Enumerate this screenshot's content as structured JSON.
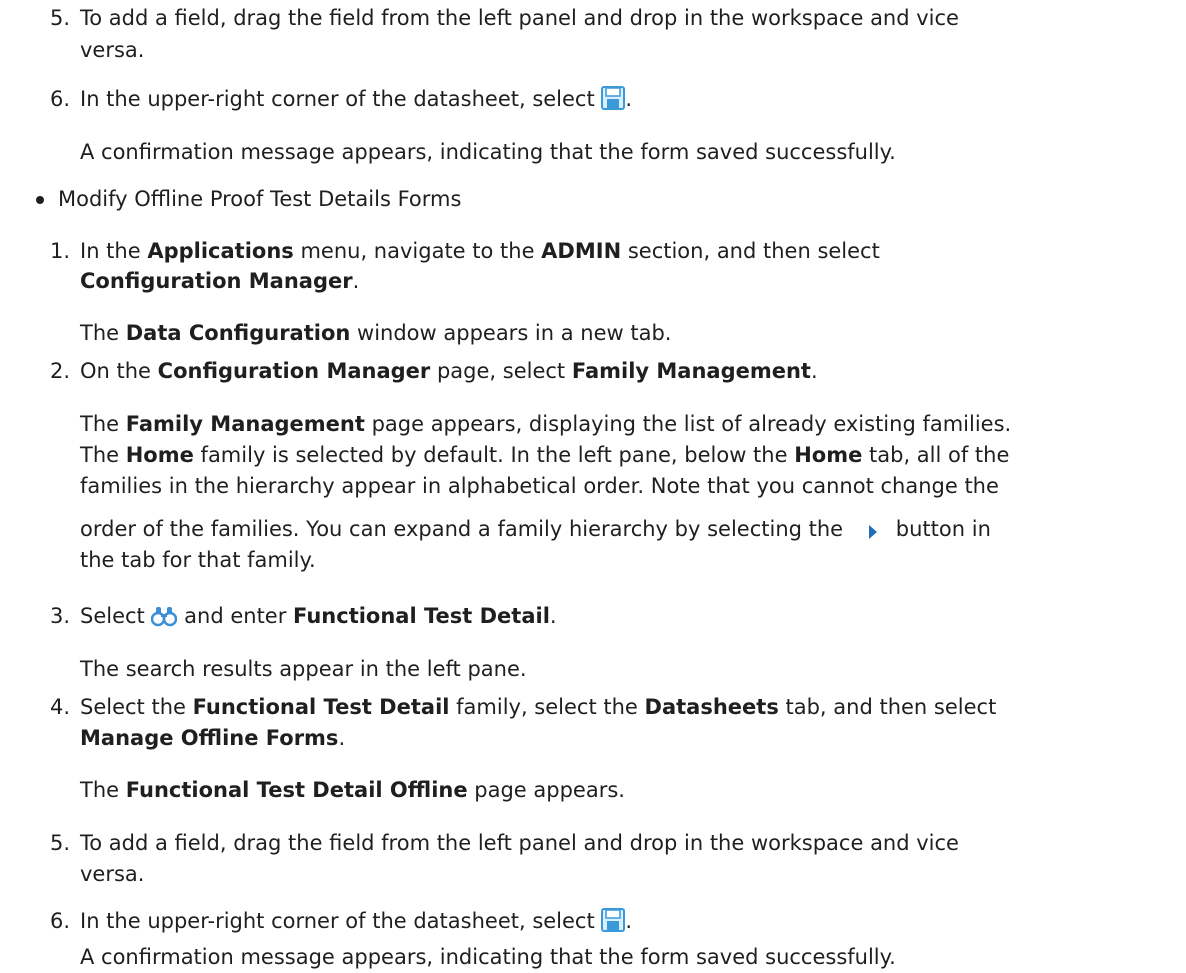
{
  "top_steps": {
    "step5": {
      "num": "5.",
      "line1": "To add a field, drag the field from the left panel and drop in the workspace and vice",
      "line2": "versa."
    },
    "step6": {
      "num": "6.",
      "text": "In the upper-right corner of the datasheet, select",
      "after_icon": ".",
      "result": "A confirmation message appears, indicating that the form saved successfully."
    }
  },
  "bullet": {
    "label": "Modify Offline Proof Test Details Forms"
  },
  "steps": {
    "s1": {
      "num": "1.",
      "a": "In the ",
      "b_applications": "Applications",
      "c": " menu, navigate to the ",
      "b_admin": "ADMIN",
      "d": " section, and then select",
      "b_config": "Configuration Manager",
      "e": ".",
      "result_a": "The ",
      "result_b": "Data Configuration",
      "result_c": " window appears in a new tab."
    },
    "s2": {
      "num": "2.",
      "a": "On the ",
      "b_config": "Configuration Manager",
      "c": " page, select ",
      "b_family": "Family Management",
      "d": ".",
      "p1_a": "The ",
      "p1_b": "Family Management",
      "p1_c": " page appears, displaying the list of already existing families.",
      "p2_a": "The ",
      "p2_b": "Home",
      "p2_c": " family is selected by default. In the left pane, below the ",
      "p2_d": "Home",
      "p2_e": " tab, all of the",
      "p3": "families in the hierarchy appear in alphabetical order. Note that you cannot change the",
      "p4_a": "order of the families. You can expand a family hierarchy by selecting the",
      "p4_b": "button in",
      "p5": "the tab for that family."
    },
    "s3": {
      "num": "3.",
      "a": "Select",
      "b": " and enter ",
      "b_term": "Functional Test Detail",
      "c": ".",
      "result": "The search results appear in the left pane."
    },
    "s4": {
      "num": "4.",
      "a": "Select the ",
      "b_ftd": "Functional Test Detail",
      "c": " family, select the ",
      "b_ds": "Datasheets",
      "d": " tab, and then select",
      "b_mof": "Manage Offline Forms",
      "e": ".",
      "result_a": "The ",
      "result_b": "Functional Test Detail Offline",
      "result_c": " page appears."
    },
    "s5": {
      "num": "5.",
      "line1": "To add a field, drag the field from the left panel and drop in the workspace and vice",
      "line2": "versa."
    },
    "s6": {
      "num": "6.",
      "text": "In the upper-right corner of the datasheet, select",
      "after_icon": ".",
      "result": "A confirmation message appears, indicating that the form saved successfully."
    }
  },
  "colors": {
    "text": "#1f1f1f",
    "save_icon": "#3a9ad9",
    "arrow_icon": "#1e6fb8",
    "binoculars_icon": "#3a8fd6"
  },
  "icons": {
    "save": "save-icon",
    "expand": "expand-arrow-icon",
    "search": "binoculars-icon"
  }
}
